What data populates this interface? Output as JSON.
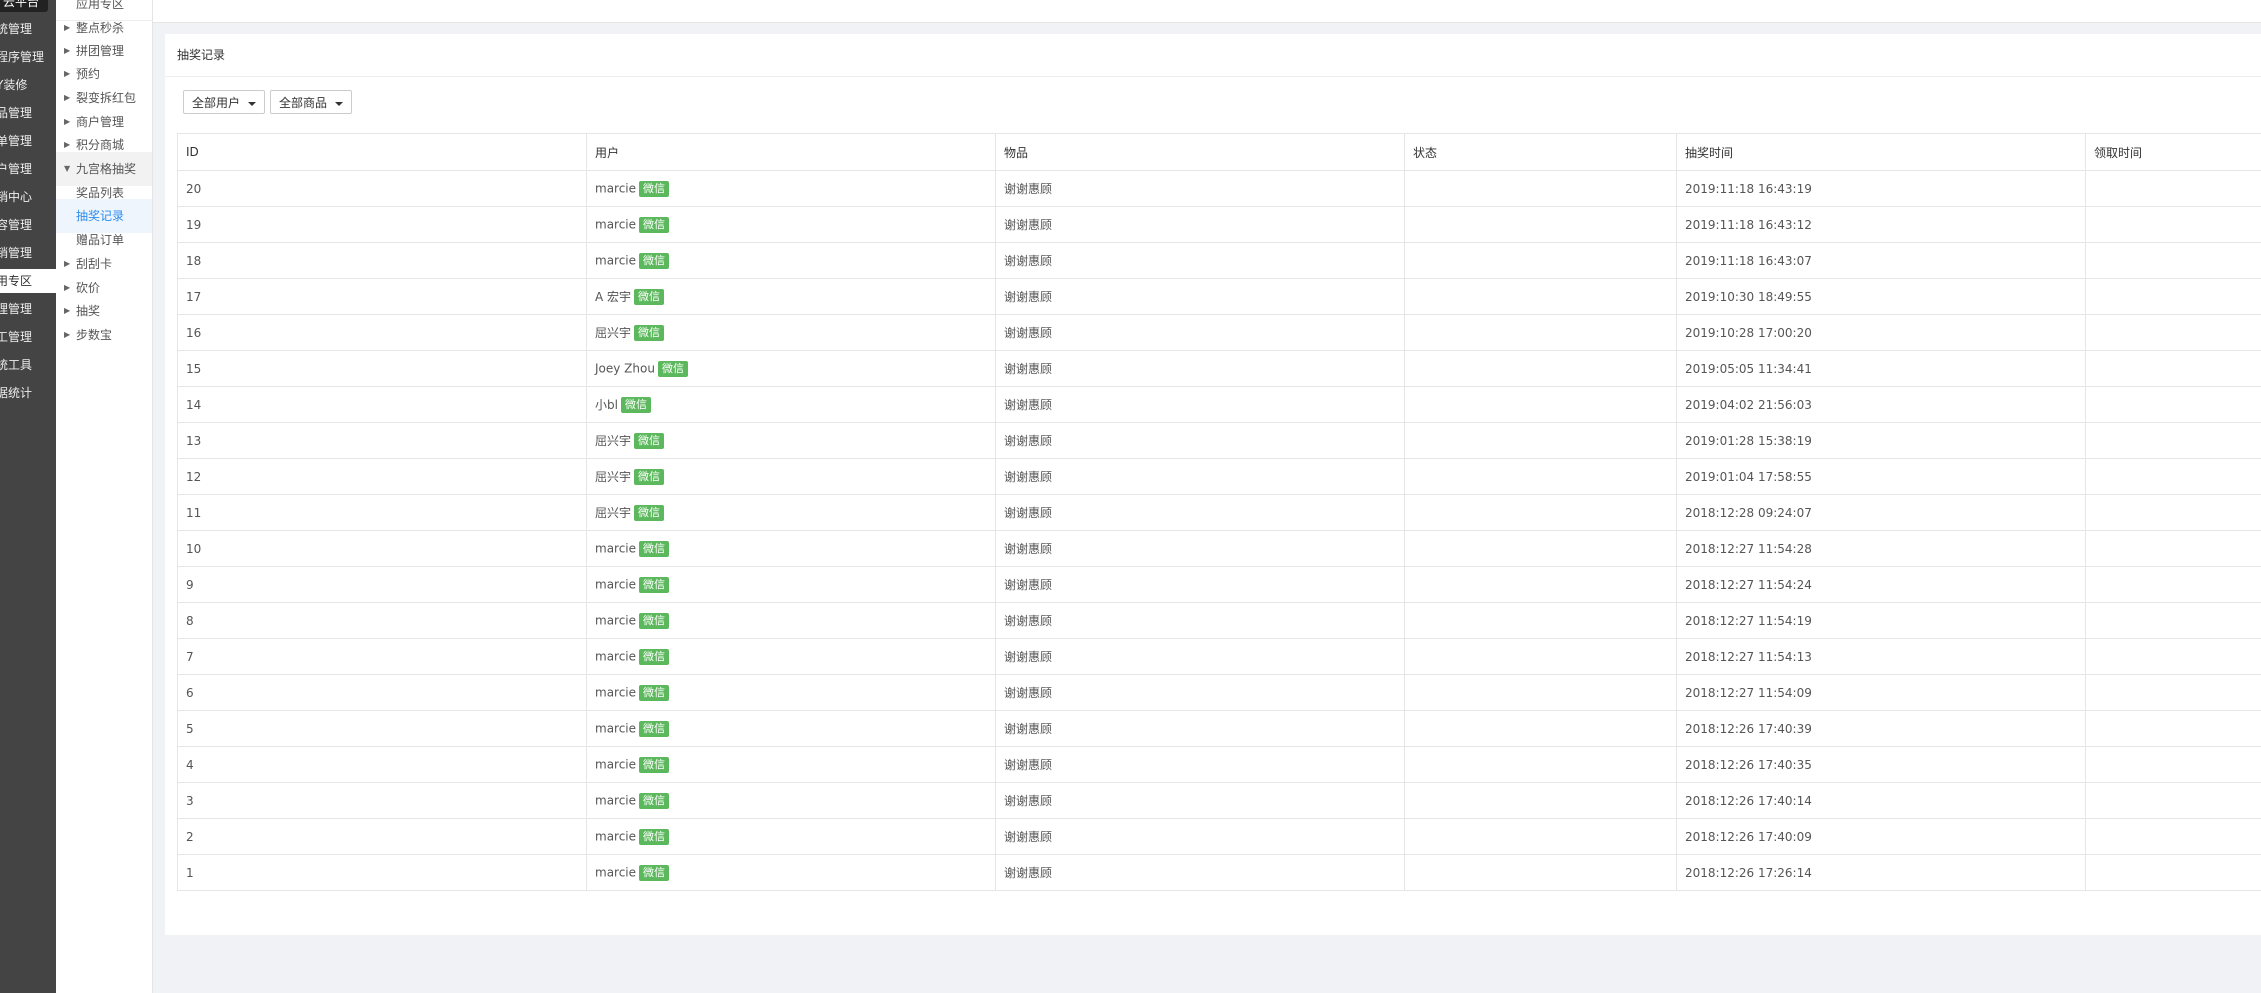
{
  "sidebar_main": {
    "brand": "云平台",
    "items": [
      {
        "label": "统管理"
      },
      {
        "label": "程序管理"
      },
      {
        "label": "Y装修"
      },
      {
        "label": "品管理"
      },
      {
        "label": "单管理"
      },
      {
        "label": "户管理"
      },
      {
        "label": "销中心"
      },
      {
        "label": "容管理"
      },
      {
        "label": "销管理"
      },
      {
        "label": "用专区"
      },
      {
        "label": "理管理"
      },
      {
        "label": "工管理"
      },
      {
        "label": "统工具"
      },
      {
        "label": "据统计"
      }
    ]
  },
  "sidebar_sub": {
    "header": "应用专区",
    "items": [
      {
        "label": "整点秒杀",
        "arrow": "▶"
      },
      {
        "label": "拼团管理",
        "arrow": "▶"
      },
      {
        "label": "预约",
        "arrow": "▶"
      },
      {
        "label": "裂变拆红包",
        "arrow": "▶"
      },
      {
        "label": "商户管理",
        "arrow": "▶"
      },
      {
        "label": "积分商城",
        "arrow": "▶"
      },
      {
        "label": "九宫格抽奖",
        "arrow": "▼"
      },
      {
        "label": "奖品列表",
        "arrow": ""
      },
      {
        "label": "抽奖记录",
        "arrow": ""
      },
      {
        "label": "赠品订单",
        "arrow": ""
      },
      {
        "label": "刮刮卡",
        "arrow": "▶"
      },
      {
        "label": "砍价",
        "arrow": "▶"
      },
      {
        "label": "抽奖",
        "arrow": "▶"
      },
      {
        "label": "步数宝",
        "arrow": "▶"
      }
    ]
  },
  "panel": {
    "title": "抽奖记录",
    "filters": {
      "user": "全部用户",
      "goods": "全部商品"
    }
  },
  "table": {
    "headers": {
      "id": "ID",
      "user": "用户",
      "item": "物品",
      "status": "状态",
      "draw_time": "抽奖时间",
      "claim_time": "领取时间"
    },
    "badge": "微信",
    "rows": [
      {
        "id": "20",
        "user": "marcie",
        "item": "谢谢惠顾",
        "status": "",
        "draw_time": "2019:11:18 16:43:19",
        "claim_time": ""
      },
      {
        "id": "19",
        "user": "marcie",
        "item": "谢谢惠顾",
        "status": "",
        "draw_time": "2019:11:18 16:43:12",
        "claim_time": ""
      },
      {
        "id": "18",
        "user": "marcie",
        "item": "谢谢惠顾",
        "status": "",
        "draw_time": "2019:11:18 16:43:07",
        "claim_time": ""
      },
      {
        "id": "17",
        "user": "A 宏宇",
        "item": "谢谢惠顾",
        "status": "",
        "draw_time": "2019:10:30 18:49:55",
        "claim_time": ""
      },
      {
        "id": "16",
        "user": "屈兴宇",
        "item": "谢谢惠顾",
        "status": "",
        "draw_time": "2019:10:28 17:00:20",
        "claim_time": ""
      },
      {
        "id": "15",
        "user": "Joey Zhou",
        "item": "谢谢惠顾",
        "status": "",
        "draw_time": "2019:05:05 11:34:41",
        "claim_time": ""
      },
      {
        "id": "14",
        "user": "小bl",
        "item": "谢谢惠顾",
        "status": "",
        "draw_time": "2019:04:02 21:56:03",
        "claim_time": ""
      },
      {
        "id": "13",
        "user": "屈兴宇",
        "item": "谢谢惠顾",
        "status": "",
        "draw_time": "2019:01:28 15:38:19",
        "claim_time": ""
      },
      {
        "id": "12",
        "user": "屈兴宇",
        "item": "谢谢惠顾",
        "status": "",
        "draw_time": "2019:01:04 17:58:55",
        "claim_time": ""
      },
      {
        "id": "11",
        "user": "屈兴宇",
        "item": "谢谢惠顾",
        "status": "",
        "draw_time": "2018:12:28 09:24:07",
        "claim_time": ""
      },
      {
        "id": "10",
        "user": "marcie",
        "item": "谢谢惠顾",
        "status": "",
        "draw_time": "2018:12:27 11:54:28",
        "claim_time": ""
      },
      {
        "id": "9",
        "user": "marcie",
        "item": "谢谢惠顾",
        "status": "",
        "draw_time": "2018:12:27 11:54:24",
        "claim_time": ""
      },
      {
        "id": "8",
        "user": "marcie",
        "item": "谢谢惠顾",
        "status": "",
        "draw_time": "2018:12:27 11:54:19",
        "claim_time": ""
      },
      {
        "id": "7",
        "user": "marcie",
        "item": "谢谢惠顾",
        "status": "",
        "draw_time": "2018:12:27 11:54:13",
        "claim_time": ""
      },
      {
        "id": "6",
        "user": "marcie",
        "item": "谢谢惠顾",
        "status": "",
        "draw_time": "2018:12:27 11:54:09",
        "claim_time": ""
      },
      {
        "id": "5",
        "user": "marcie",
        "item": "谢谢惠顾",
        "status": "",
        "draw_time": "2018:12:26 17:40:39",
        "claim_time": ""
      },
      {
        "id": "4",
        "user": "marcie",
        "item": "谢谢惠顾",
        "status": "",
        "draw_time": "2018:12:26 17:40:35",
        "claim_time": ""
      },
      {
        "id": "3",
        "user": "marcie",
        "item": "谢谢惠顾",
        "status": "",
        "draw_time": "2018:12:26 17:40:14",
        "claim_time": ""
      },
      {
        "id": "2",
        "user": "marcie",
        "item": "谢谢惠顾",
        "status": "",
        "draw_time": "2018:12:26 17:40:09",
        "claim_time": ""
      },
      {
        "id": "1",
        "user": "marcie",
        "item": "谢谢惠顾",
        "status": "",
        "draw_time": "2018:12:26 17:26:14",
        "claim_time": ""
      }
    ]
  }
}
